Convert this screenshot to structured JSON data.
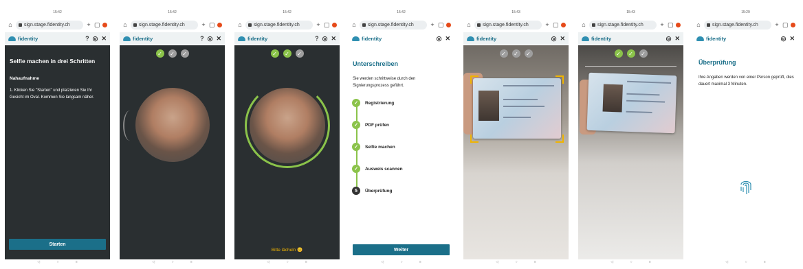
{
  "common": {
    "url": "sign.stage.fidentity.ch",
    "brand": "fidentity"
  },
  "statusbars": [
    "15:42",
    "15:42",
    "15:42",
    "15:42",
    "15:43",
    "15:43",
    "15:29"
  ],
  "screen1": {
    "title": "Selfie machen in drei Schritten",
    "subtitle": "Nahaufnahme",
    "instruction": "1. Klicken Sie \"Starten\" und platzieren Sie Ihr Gesicht im Oval. Kommen Sie langsam näher.",
    "button": "Starten"
  },
  "screen3": {
    "prompt": "Bitte lächeln 😊"
  },
  "screen4": {
    "title": "Unterschreiben",
    "intro": "Sie werden schrittweise durch den Signierungsprozess geführt.",
    "steps": [
      "Registrierung",
      "PDF prüfen",
      "Selfie machen",
      "Ausweis scannen",
      "Überprüfung"
    ],
    "last_step_number": "5",
    "button": "Weiter"
  },
  "screen7": {
    "title": "Überprüfung",
    "text": "Ihre Angaben werden von einer Person geprüft, dies dauert maximal 3 Minuten."
  },
  "colors": {
    "teal": "#1b6f89",
    "green_check": "#8bc34a",
    "dark_bg": "#2a2f31",
    "frame_yellow": "#f0b400"
  }
}
